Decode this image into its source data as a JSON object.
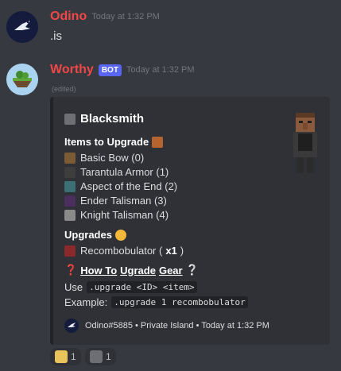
{
  "messages": [
    {
      "author": "Odino",
      "author_color": "#f04747",
      "timestamp": "Today at 1:32 PM",
      "avatar_icon": "bird-avatar",
      "content": ".is"
    },
    {
      "author": "Worthy",
      "author_color": "#f04747",
      "bot_tag": "BOT",
      "timestamp": "Today at 1:32 PM",
      "avatar_icon": "floating-island-avatar",
      "edited": "(edited)"
    }
  ],
  "embed": {
    "title": "Blacksmith",
    "title_icon": "anvil-icon",
    "thumbnail_icon": "villager-blacksmith",
    "items_header": "Items to Upgrade",
    "items_header_icon": "briefcase-icon",
    "items": [
      {
        "icon": "bow-icon",
        "label": "Basic Bow (0)"
      },
      {
        "icon": "tarantula-armor-icon",
        "label": "Tarantula Armor (1)"
      },
      {
        "icon": "sword-icon",
        "label": "Aspect of the End (2)"
      },
      {
        "icon": "ender-talisman-icon",
        "label": "Ender Talisman (3)"
      },
      {
        "icon": "knight-talisman-icon",
        "label": "Knight Talisman (4)"
      }
    ],
    "upgrades_header": "Upgrades",
    "upgrades_header_icon": "sun-icon",
    "upgrades": [
      {
        "icon": "recombobulator-icon",
        "label": "Recombobulator (",
        "count": "x1",
        "suffix": ")"
      }
    ],
    "how_to": {
      "q_left": "❓",
      "how": "How To",
      "ugrade": "Ugrade",
      "gear": "Gear",
      "q_right": "❔"
    },
    "use_label": "Use",
    "use_code": ".upgrade <ID> <item>",
    "example_label": "Example:",
    "example_code": ".upgrade 1 recombobulator",
    "footer_text": "Odino#5885 • Private Island • Today at 1:32 PM",
    "footer_icon": "bird-avatar"
  },
  "reactions": [
    {
      "icon": "island-icon",
      "count": "1"
    },
    {
      "icon": "anvil-icon",
      "count": "1"
    }
  ],
  "colors": {
    "background": "#36393f",
    "embed_bg": "#2f3136",
    "embed_border": "#202225",
    "bot_tag": "#5865f2",
    "username": "#f04747"
  }
}
